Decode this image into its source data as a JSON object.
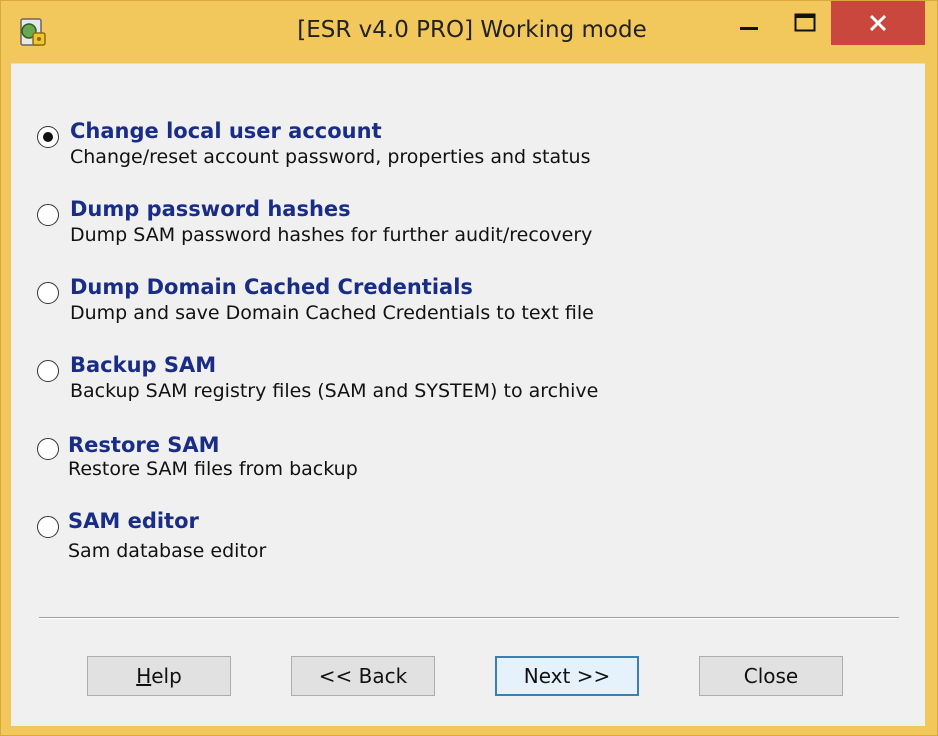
{
  "window": {
    "title": "[ESR v4.0 PRO]  Working mode",
    "colors": {
      "frame": "#f2c85c",
      "close_button": "#c9473d",
      "option_title": "#1a2d86"
    },
    "icons": {
      "app": "app-icon",
      "minimize": "minimize-icon",
      "maximize": "maximize-icon",
      "close": "close-icon"
    }
  },
  "options": [
    {
      "title": "Change local user account",
      "description": "Change/reset account password, properties and status",
      "selected": true
    },
    {
      "title": "Dump password hashes",
      "description": "Dump SAM password hashes for further audit/recovery",
      "selected": false
    },
    {
      "title": "Dump Domain Cached Credentials",
      "description": "Dump and save Domain Cached Credentials to text file",
      "selected": false
    },
    {
      "title": "Backup SAM",
      "description": "Backup SAM registry files (SAM and SYSTEM) to archive",
      "selected": false
    },
    {
      "title": "Restore SAM",
      "description": "Restore SAM files from backup",
      "selected": false
    },
    {
      "title": "SAM editor",
      "description": "Sam database editor",
      "selected": false
    }
  ],
  "buttons": {
    "help_accel": "H",
    "help_rest": "elp",
    "back": "<< Back",
    "next": "Next >>",
    "close": "Close"
  }
}
